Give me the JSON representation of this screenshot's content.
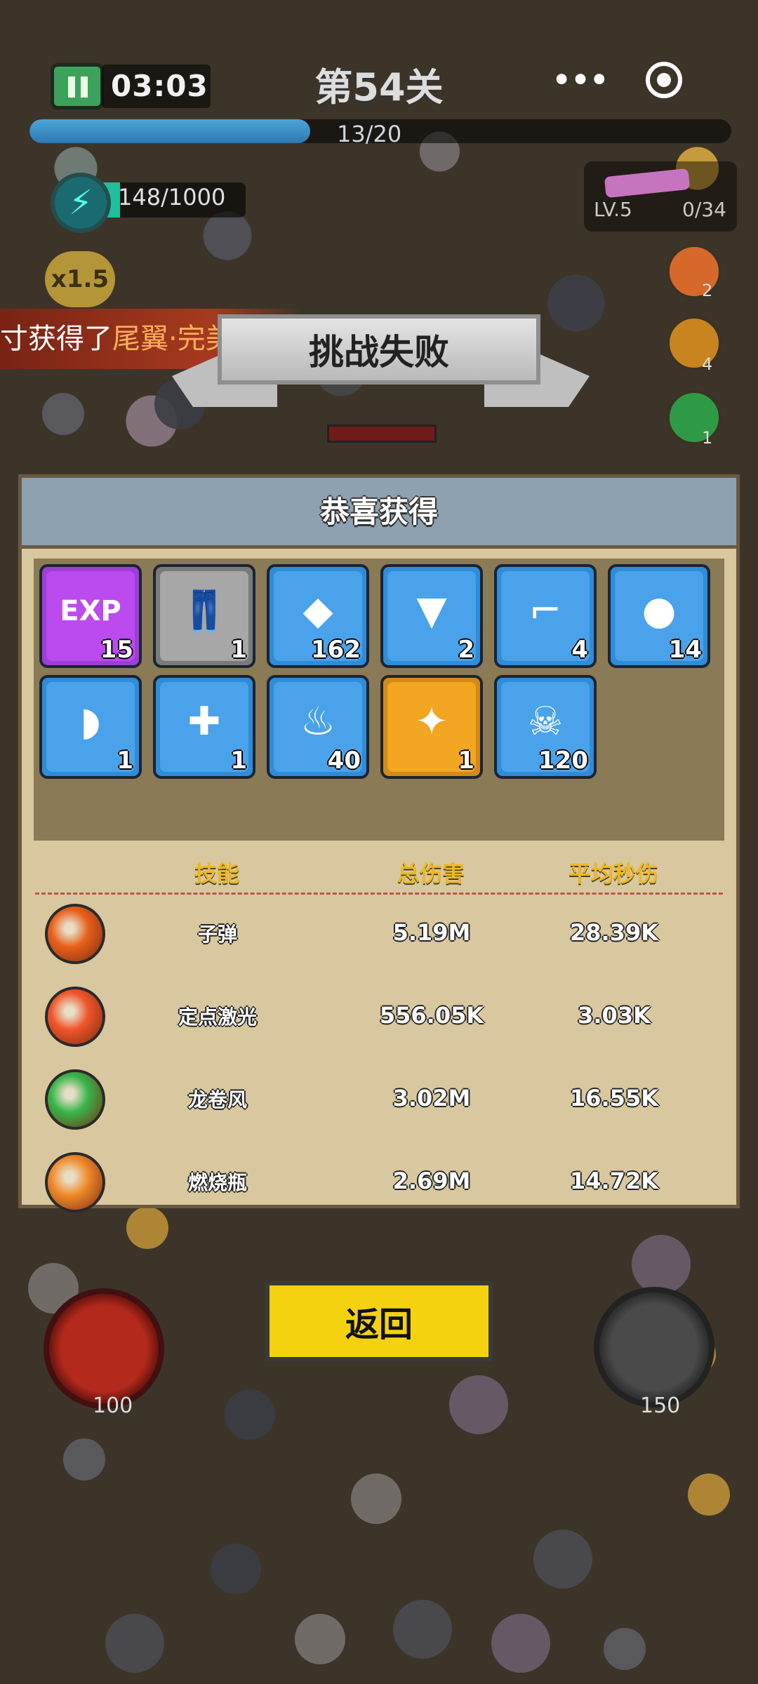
{
  "hud": {
    "timer": "03:03",
    "level_title": "第54关",
    "menu_label": "•••",
    "wave_progress": "13/20",
    "wave_fraction": 0.4,
    "energy": "148/1000",
    "energy_fraction": 0.148,
    "weapon_level": "LV.5",
    "weapon_count": "0/34",
    "speed": "x1.5",
    "side_skills": [
      {
        "icon": "molotov-icon",
        "count": "2"
      },
      {
        "icon": "spiked-wheel-icon",
        "count": "4"
      },
      {
        "icon": "tornado-icon",
        "count": "1"
      }
    ]
  },
  "notice": {
    "prefix": "寸获得了",
    "highlight": "尾翼·完美芯片"
  },
  "banner": {
    "title": "挑战失败"
  },
  "panel": {
    "title": "恭喜获得",
    "rewards": [
      {
        "icon": "exp-icon",
        "glyph": "EXP",
        "qty": "15",
        "rarity": "purple"
      },
      {
        "icon": "pants-icon",
        "glyph": "👖",
        "qty": "1",
        "rarity": "gray"
      },
      {
        "icon": "crystal-cube-icon",
        "glyph": "◆",
        "qty": "162",
        "rarity": "blue"
      },
      {
        "icon": "blueprint-chip-icon",
        "glyph": "▼",
        "qty": "2",
        "rarity": "blue"
      },
      {
        "icon": "pistol-blueprint-icon",
        "glyph": "⌐",
        "qty": "4",
        "rarity": "blue"
      },
      {
        "icon": "purple-orb-icon",
        "glyph": "●",
        "qty": "14",
        "rarity": "blue"
      },
      {
        "icon": "shoe-blueprint-icon",
        "glyph": "◗",
        "qty": "1",
        "rarity": "blue"
      },
      {
        "icon": "wrench-blueprint-icon",
        "glyph": "✚",
        "qty": "1",
        "rarity": "blue"
      },
      {
        "icon": "flame-helmet-icon",
        "glyph": "♨",
        "qty": "40",
        "rarity": "blue"
      },
      {
        "icon": "tail-chip-icon",
        "glyph": "✦",
        "qty": "1",
        "rarity": "gold"
      },
      {
        "icon": "skull-coin-icon",
        "glyph": "☠",
        "qty": "120",
        "rarity": "blue"
      }
    ],
    "stats_headers": [
      "技能",
      "总伤害",
      "平均秒伤"
    ],
    "stats": [
      {
        "icon": "bullet-gun-icon",
        "name": "子弹",
        "total": "5.19M",
        "dps": "28.39K",
        "color": "#e8601c"
      },
      {
        "icon": "laser-icon",
        "name": "定点激光",
        "total": "556.05K",
        "dps": "3.03K",
        "color": "#f0552a"
      },
      {
        "icon": "tornado-icon",
        "name": "龙卷风",
        "total": "3.02M",
        "dps": "16.55K",
        "color": "#37b54a"
      },
      {
        "icon": "molotov-icon",
        "name": "燃烧瓶",
        "total": "2.69M",
        "dps": "14.72K",
        "color": "#f08a2a"
      }
    ]
  },
  "bottom": {
    "return_label": "返回",
    "left_skill_cost": "100",
    "right_skill_cost": "150"
  }
}
